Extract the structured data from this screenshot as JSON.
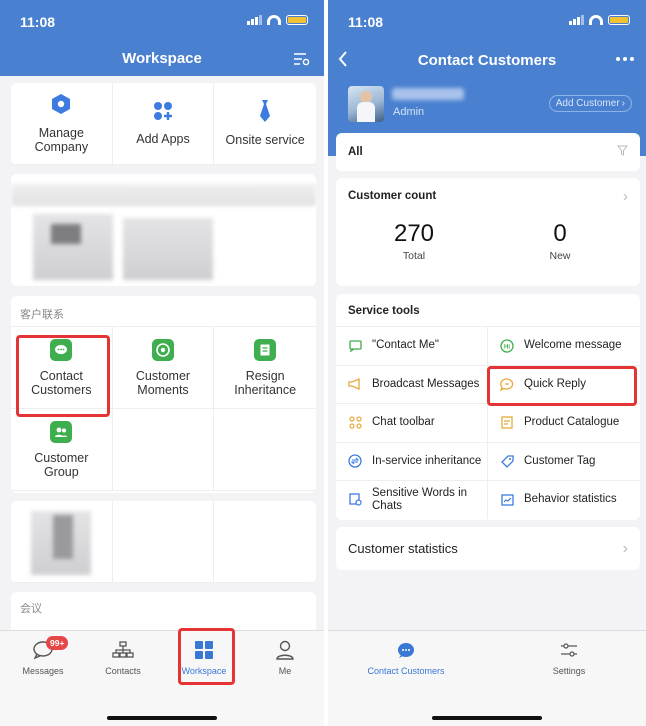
{
  "status": {
    "time": "11:08"
  },
  "left": {
    "title": "Workspace",
    "top_apps": [
      {
        "label": "Manage Company",
        "icon": "hexagon-icon"
      },
      {
        "label": "Add Apps",
        "icon": "add-apps-icon"
      },
      {
        "label": "Onsite service",
        "icon": "tie-icon"
      }
    ],
    "section1": "客户联系",
    "customer_apps": [
      {
        "label": "Contact Customers",
        "icon": "chat-bubble-icon"
      },
      {
        "label": "Customer Moments",
        "icon": "shutter-icon"
      },
      {
        "label": "Resign Inheritance",
        "icon": "document-icon"
      },
      {
        "label": "Customer Group",
        "icon": "group-icon"
      }
    ],
    "section2": "会议",
    "tabs": [
      {
        "label": "Messages",
        "badge": "99+"
      },
      {
        "label": "Contacts"
      },
      {
        "label": "Workspace"
      },
      {
        "label": "Me"
      }
    ]
  },
  "right": {
    "title": "Contact Customers",
    "user_role": "Admin",
    "add_customer": "Add Customer",
    "filter": "All",
    "count_title": "Customer count",
    "total_value": "270",
    "total_label": "Total",
    "new_value": "0",
    "new_label": "New",
    "tools_title": "Service tools",
    "tools": [
      {
        "label": "\"Contact Me\"",
        "icon": "contact-me-icon"
      },
      {
        "label": "Welcome message",
        "icon": "hi-icon"
      },
      {
        "label": "Broadcast Messages",
        "icon": "megaphone-icon"
      },
      {
        "label": "Quick Reply",
        "icon": "reply-bubble-icon"
      },
      {
        "label": "Chat toolbar",
        "icon": "toolbar-icon"
      },
      {
        "label": "Product Catalogue",
        "icon": "catalogue-icon"
      },
      {
        "label": "In-service inheritance",
        "icon": "transfer-icon"
      },
      {
        "label": "Customer Tag",
        "icon": "tag-icon"
      },
      {
        "label": "Sensitive Words in Chats",
        "icon": "sensitive-icon"
      },
      {
        "label": "Behavior statistics",
        "icon": "stats-icon"
      }
    ],
    "statistics": "Customer statistics",
    "tabs": [
      {
        "label": "Contact Customers"
      },
      {
        "label": "Settings"
      }
    ]
  },
  "colors": {
    "nav": "#4a80d0",
    "highlight": "#e53434",
    "green": "#3fae4f",
    "active_tab": "#3a78d6"
  }
}
